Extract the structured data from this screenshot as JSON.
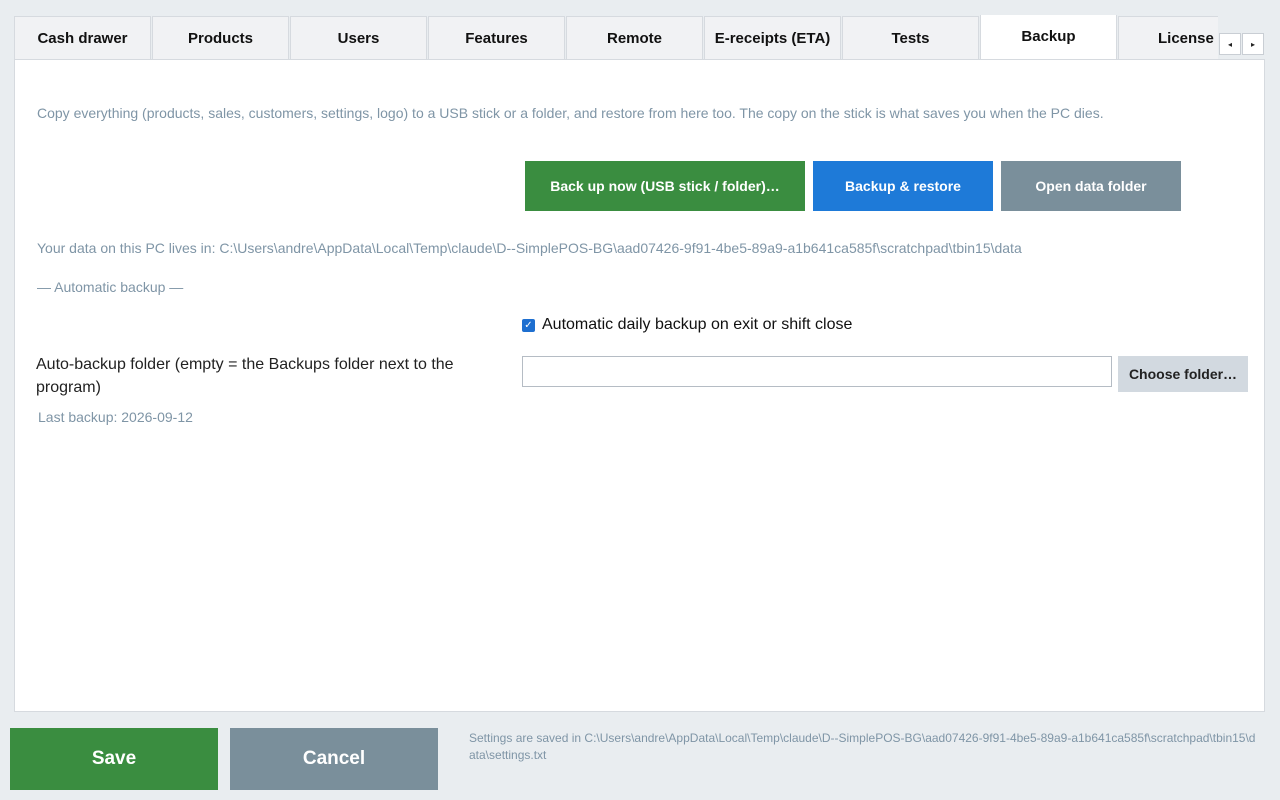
{
  "tabs": [
    {
      "label": "Cash drawer"
    },
    {
      "label": "Products"
    },
    {
      "label": "Users"
    },
    {
      "label": "Features"
    },
    {
      "label": "Remote"
    },
    {
      "label": "E-receipts (ETA)"
    },
    {
      "label": "Tests"
    },
    {
      "label": "Backup",
      "active": true
    },
    {
      "label": "License"
    }
  ],
  "tab_scroll": {
    "left": "◂",
    "right": "▸"
  },
  "backup": {
    "description": "Copy everything (products, sales, customers, settings, logo) to a USB stick or a folder, and restore from here too. The copy on the stick is what saves you when the PC dies.",
    "backup_now_label": "Back up now (USB stick / folder)…",
    "backup_restore_label": "Backup & restore",
    "open_folder_label": "Open data folder",
    "data_path": "Your data on this PC lives in: C:\\Users\\andre\\AppData\\Local\\Temp\\claude\\D--SimplePOS-BG\\aad07426-9f91-4be5-89a9-a1b641ca585f\\scratchpad\\tbin15\\data",
    "section_title": "— Automatic backup —",
    "auto_daily_label": "Automatic daily backup on exit or shift close",
    "auto_daily_checked": true,
    "folder_label": "Auto-backup folder (empty = the Backups folder next to the program)",
    "folder_value": "",
    "choose_folder_label": "Choose folder…",
    "last_backup": "Last backup: 2026-09-12"
  },
  "footer": {
    "save_label": "Save",
    "cancel_label": "Cancel",
    "saved_info": "Settings are saved in C:\\Users\\andre\\AppData\\Local\\Temp\\claude\\D--SimplePOS-BG\\aad07426-9f91-4be5-89a9-a1b641ca585f\\scratchpad\\tbin15\\data\\settings.txt"
  },
  "colors": {
    "primary_green": "#3a8d40",
    "primary_blue": "#1e7ad8",
    "neutral_gray": "#7a8f9b",
    "muted_text": "#7f95a6"
  }
}
